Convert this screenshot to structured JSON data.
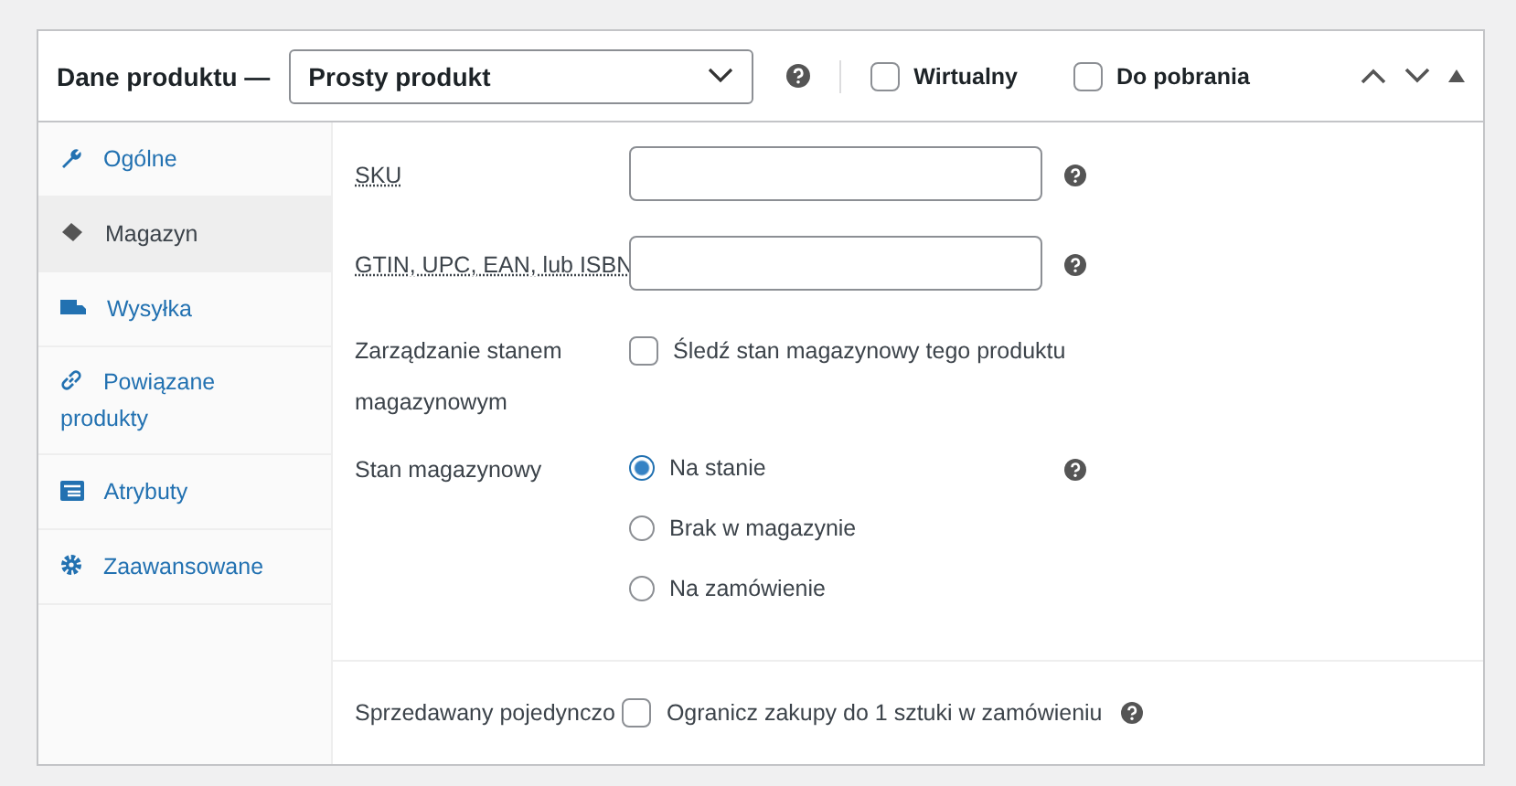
{
  "header": {
    "title": "Dane produktu —",
    "product_type": "Prosty produkt",
    "virtual": {
      "label": "Wirtualny",
      "checked": false
    },
    "downloadable": {
      "label": "Do pobrania",
      "checked": false
    }
  },
  "tabs": [
    {
      "label": "Ogólne",
      "selected": false
    },
    {
      "label": "Magazyn",
      "selected": true
    },
    {
      "label": "Wysyłka",
      "selected": false
    },
    {
      "label": "Powiązane produkty",
      "selected": false
    },
    {
      "label": "Atrybuty",
      "selected": false
    },
    {
      "label": "Zaawansowane",
      "selected": false
    }
  ],
  "fields": [
    {
      "kind": "text",
      "label": "SKU",
      "help": true
    },
    {
      "kind": "text",
      "label": "GTIN, UPC, EAN, lub ISBN",
      "help": true
    },
    {
      "kind": "checkbox",
      "label": "Zarządzanie stanem magazynowym",
      "option": "Śledź stan magazynowy tego produktu",
      "checked": false,
      "help": false
    },
    {
      "kind": "radio",
      "label": "Stan magazynowy",
      "help": true,
      "options": [
        {
          "label": "Na stanie",
          "selected": true
        },
        {
          "label": "Brak w magazynie",
          "selected": false
        },
        {
          "label": "Na zamówienie",
          "selected": false
        }
      ]
    }
  ],
  "sold_individually": {
    "label": "Sprzedawany pojedynczo",
    "option": "Ogranicz zakupy do 1 sztuki w zamówieniu",
    "checked": false
  }
}
